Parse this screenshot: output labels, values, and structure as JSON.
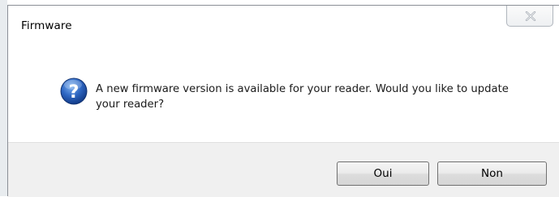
{
  "dialog": {
    "title": "Firmware",
    "message": "A new firmware version is available for your reader. Would you like to update your reader?",
    "icon": "question-icon",
    "buttons": {
      "yes_label": "Oui",
      "no_label": "Non"
    }
  },
  "colors": {
    "icon_blue": "#2a5fb8",
    "button_bar": "#f0f0f0"
  }
}
